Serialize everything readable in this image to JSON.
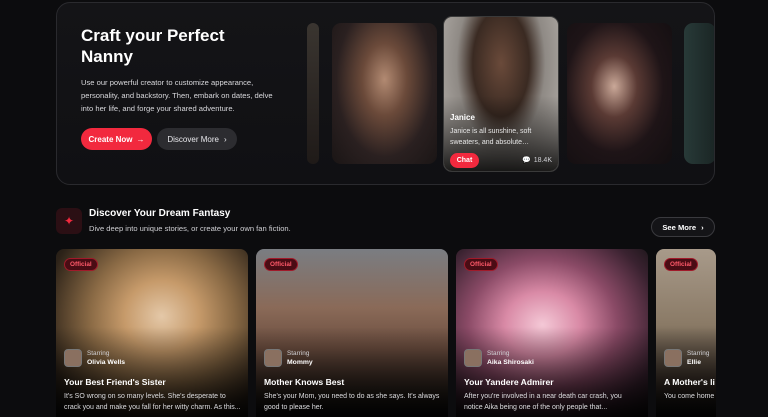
{
  "hero": {
    "title": "Craft your Perfect Nanny",
    "description": "Use our powerful creator to customize appearance, personality, and backstory. Then, embark on dates, delve into her life, and forge your shared adventure.",
    "create_button": "Create Now",
    "discover_button": "Discover More",
    "featured": {
      "name": "Janice",
      "description": "Janice is all sunshine, soft sweaters, and absolute…",
      "chat_button": "Chat",
      "count": "18.4K"
    }
  },
  "section": {
    "title": "Discover Your Dream Fantasy",
    "subtitle": "Dive deep into unique stories, or create your own fan fiction.",
    "see_more": "See More"
  },
  "cards": [
    {
      "badge": "Official",
      "starring_label": "Starring",
      "starring": "Olivia Wells",
      "title": "Your Best Friend's Sister",
      "description": "It's SO wrong on so many levels. She's desperate to crack you and make you fall for her witty charm. As this..."
    },
    {
      "badge": "Official",
      "starring_label": "Starring",
      "starring": "Mommy",
      "title": "Mother Knows Best",
      "description": "She's your Mom, you need to do as she says. It's always good to please her."
    },
    {
      "badge": "Official",
      "starring_label": "Starring",
      "starring": "Aika Shirosaki",
      "title": "Your Yandere Admirer",
      "description": "After you're involved in a near death car crash, you notice Aika being one of the only people that..."
    },
    {
      "badge": "Official",
      "starring_label": "Starring",
      "starring": "Ellie",
      "title": "A Mother's li",
      "description": "You come home chaos of the day"
    }
  ],
  "icons": {
    "arrow": "arrow-right-icon",
    "chevron": "chevron-right-icon",
    "chat_count": "chat-bubbles-icon",
    "section": "sparkle-icon"
  },
  "colors": {
    "accent": "#f2293e",
    "background": "#0c0c0e"
  }
}
